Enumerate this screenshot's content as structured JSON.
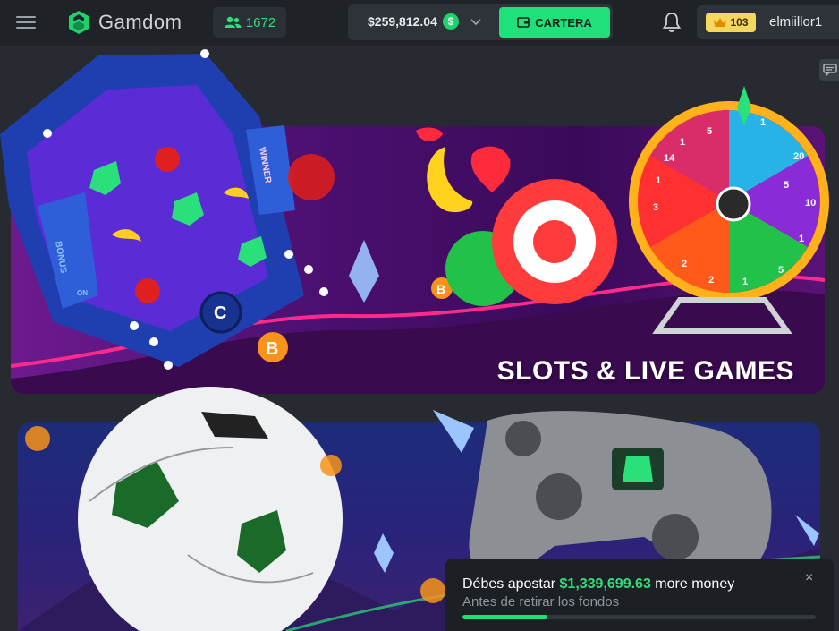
{
  "header": {
    "brand": "Gamdom",
    "online_count": "1672",
    "balance": "$259,812.04",
    "coin_symbol": "$",
    "wallet_button": "CARTERA",
    "level": "103",
    "username": "elmiillor1",
    "icons": [
      "menu-icon",
      "users-icon",
      "chevron-down-icon",
      "wallet-icon",
      "bell-icon",
      "crown-icon",
      "chat-icon"
    ]
  },
  "banners": [
    {
      "title": "SLOTS & LIVE GAMES",
      "art_labels": [
        "BONUS",
        "WINNER",
        "ON",
        "BONUS"
      ]
    },
    {
      "title": ""
    }
  ],
  "wheel": {
    "numbers": [
      "5",
      "1",
      "20",
      "10",
      "1",
      "5",
      "1",
      "2",
      "2",
      "3",
      "1",
      "14",
      "1",
      "5"
    ]
  },
  "toast": {
    "prefix": "Débes apostar",
    "amount": "$1,339,699.63",
    "suffix": "more money",
    "subtitle": "Antes de retirar los fondos",
    "close": "×",
    "progress": 0.24
  },
  "colors": {
    "accent": "#1fe07a",
    "background": "#272b31",
    "topbar": "#1f2226"
  }
}
